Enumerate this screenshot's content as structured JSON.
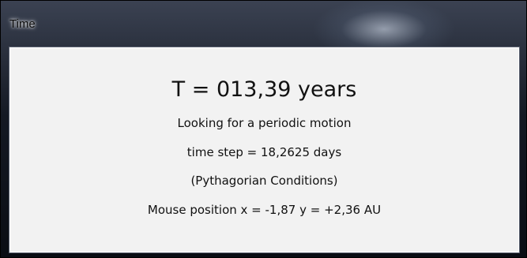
{
  "window": {
    "title": "Time"
  },
  "display": {
    "time_readout": "T = 013,39 years",
    "status": "Looking for a periodic motion",
    "time_step": "time step = 18,2625 days",
    "conditions": "(Pythagorian Conditions)",
    "mouse_position": "Mouse position x = -1,87 y = +2,36 AU"
  }
}
